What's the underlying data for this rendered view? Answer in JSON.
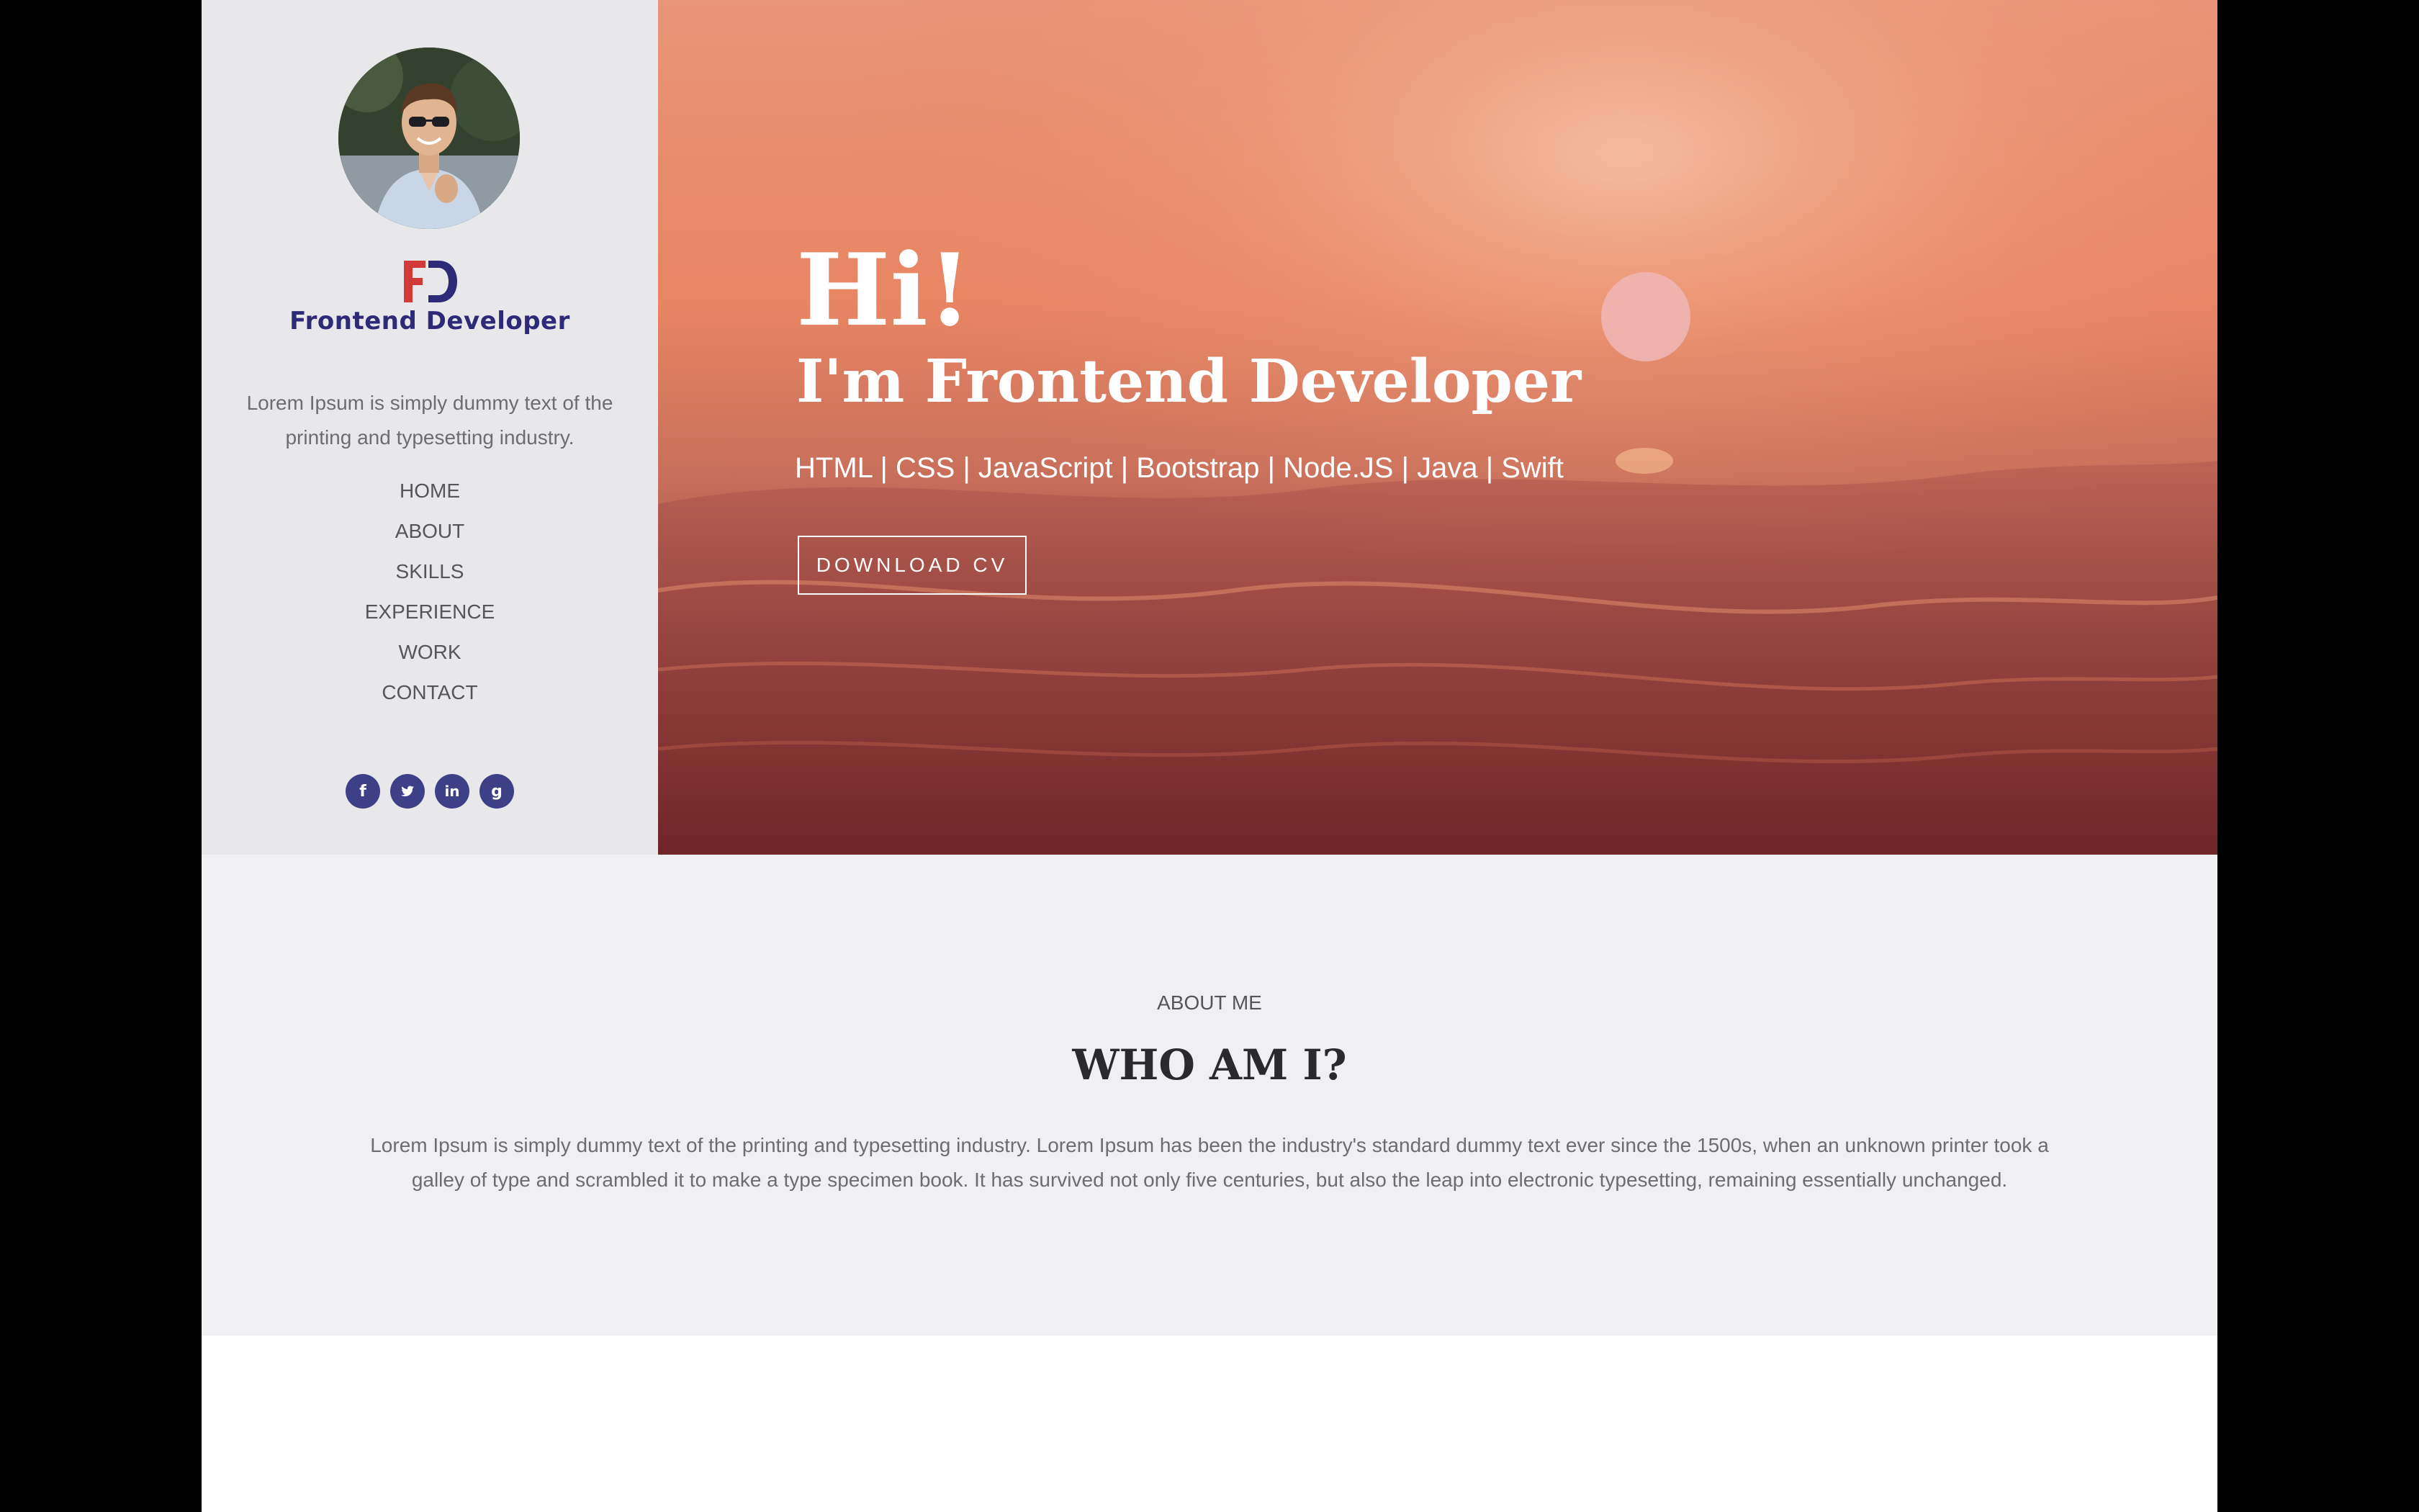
{
  "sidebar": {
    "brand": {
      "mark": "FD",
      "name": "Frontend Developer",
      "mark_colors": {
        "f": "#d23a3a",
        "d": "#2d2b78"
      }
    },
    "intro": "Lorem Ipsum is simply dummy text of the printing and typesetting industry.",
    "nav": [
      {
        "label": "HOME"
      },
      {
        "label": "ABOUT"
      },
      {
        "label": "SKILLS"
      },
      {
        "label": "EXPERIENCE"
      },
      {
        "label": "WORK"
      },
      {
        "label": "CONTACT"
      }
    ],
    "social": [
      {
        "icon": "facebook-icon",
        "glyph": "f"
      },
      {
        "icon": "twitter-icon",
        "glyph": ""
      },
      {
        "icon": "linkedin-icon",
        "glyph": "in"
      },
      {
        "icon": "google-icon",
        "glyph": "g"
      }
    ],
    "social_color": "#3d3f87"
  },
  "hero": {
    "title": "Hi!",
    "subtitle": "I'm Frontend Developer",
    "skills": "HTML | CSS | JavaScript | Bootstrap | Node.JS | Java | Swift",
    "cta_label": "DOWNLOAD CV"
  },
  "about": {
    "eyebrow": "ABOUT ME",
    "title": "WHO AM I?",
    "text": "Lorem Ipsum is simply dummy text of the printing and typesetting industry. Lorem Ipsum has been the industry's standard dummy text ever since the 1500s, when an unknown printer took a galley of type and scrambled it to make a type specimen book. It has survived not only five centuries, but also the leap into electronic typesetting, remaining essentially unchanged."
  }
}
